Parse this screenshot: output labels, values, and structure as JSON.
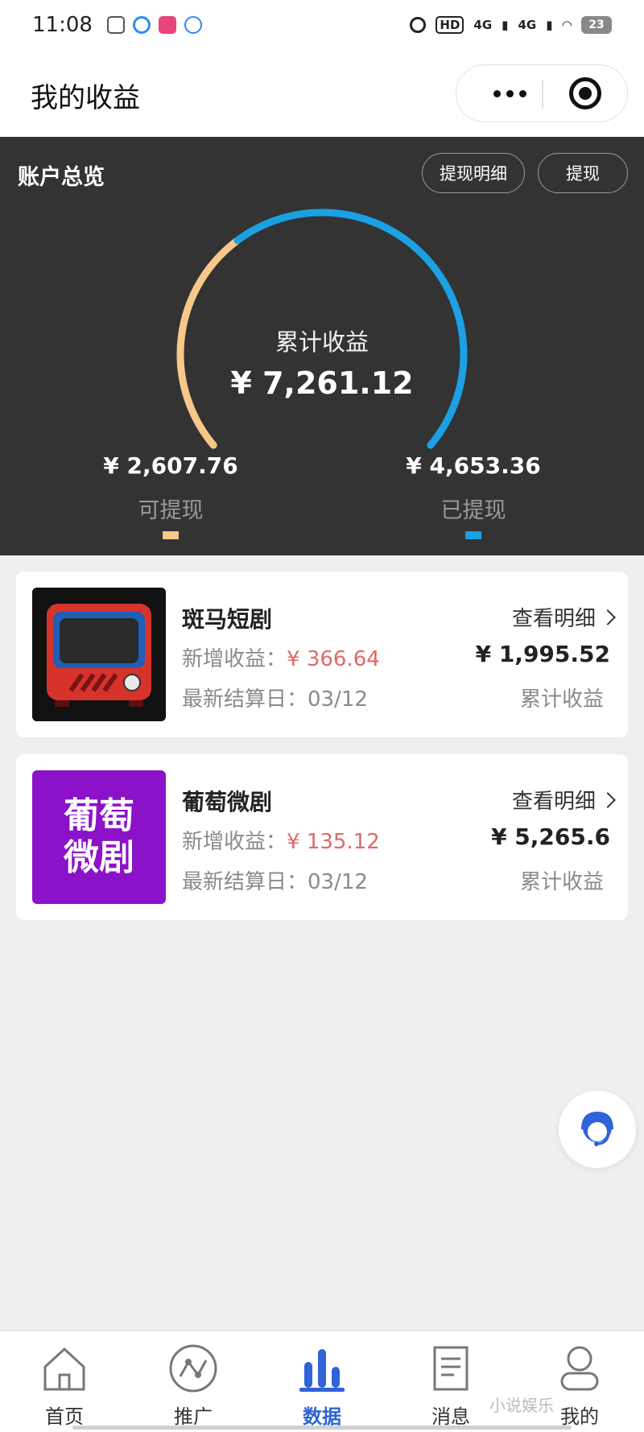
{
  "status_bar": {
    "time": "11:08",
    "network_hd": "HD",
    "network_1": "4G",
    "network_2": "4G",
    "battery": "23"
  },
  "header": {
    "title": "我的收益"
  },
  "overview": {
    "title": "账户总览",
    "detail_button": "提现明细",
    "withdraw_button": "提现",
    "total_label": "累计收益",
    "total_value": "¥ 7,261.12",
    "withdrawable_value": "¥ 2,607.76",
    "withdrawable_label": "可提现",
    "withdrawn_value": "¥ 4,653.36",
    "withdrawn_label": "已提现",
    "withdrawable_amount": 2607.76,
    "withdrawn_amount": 4653.36,
    "colors": {
      "withdrawable": "#f7c88a",
      "withdrawn": "#1ba0e4"
    }
  },
  "cards": [
    {
      "name": "斑马短剧",
      "new_income_label": "新增收益：",
      "new_income_value": "¥ 366.64",
      "settle_label": "最新结算日：",
      "settle_date": "03/12",
      "link": "查看明细",
      "total_value": "¥ 1,995.52",
      "total_label": "累计收益"
    },
    {
      "name": "葡萄微剧",
      "thumb_line1": "葡萄",
      "thumb_line2": "微剧",
      "new_income_label": "新增收益：",
      "new_income_value": "¥ 135.12",
      "settle_label": "最新结算日：",
      "settle_date": "03/12",
      "link": "查看明细",
      "total_value": "¥ 5,265.6",
      "total_label": "累计收益"
    }
  ],
  "nav": {
    "items": [
      {
        "label": "首页",
        "icon": "home-icon"
      },
      {
        "label": "推广",
        "icon": "promote-icon"
      },
      {
        "label": "数据",
        "icon": "data-icon",
        "active": true
      },
      {
        "label": "消息",
        "icon": "message-icon"
      },
      {
        "label": "我的",
        "icon": "profile-icon"
      }
    ],
    "active_color": "#2f63d8"
  },
  "watermark": "小说娱乐"
}
